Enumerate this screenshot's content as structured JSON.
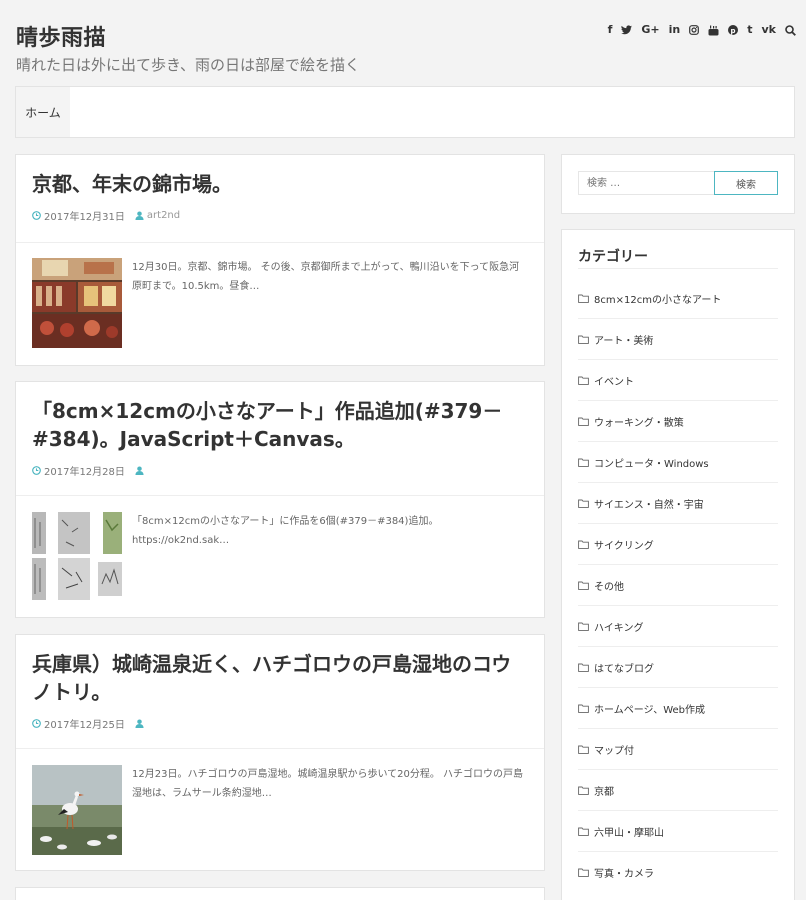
{
  "site": {
    "title": "晴歩雨描",
    "tagline": "晴れた日は外に出て歩き、雨の日は部屋で絵を描く"
  },
  "social": {
    "icons": [
      "facebook-icon",
      "twitter-icon",
      "google-plus-icon",
      "linkedin-icon",
      "instagram-icon",
      "youtube-icon",
      "pinterest-icon",
      "tumblr-icon",
      "vk-icon",
      "search-icon"
    ],
    "glyphs": [
      "f",
      "t",
      "G+",
      "in",
      "ig",
      "yt",
      "p",
      "t",
      "vk",
      ""
    ]
  },
  "nav": {
    "home": "ホーム"
  },
  "posts": [
    {
      "title": "京都、年末の錦市場。",
      "date": "2017年12月31日",
      "author": "art2nd",
      "excerpt": "12月30日。京都、錦市場。 その後、京都御所まで上がって、鴨川沿いを下って阪急河原町まで。10.5km。昼食…"
    },
    {
      "title": "「8cm×12cmの小さなアート」作品追加(#379－#384)。JavaScript＋Canvas。",
      "date": "2017年12月28日",
      "author": "",
      "excerpt": "「8cm×12cmの小さなアート」に作品を6個(#379－#384)追加。 https://ok2nd.sak…"
    },
    {
      "title": "兵庫県）城崎温泉近く、ハチゴロウの戸島湿地のコウノトリ。",
      "date": "2017年12月25日",
      "author": "",
      "excerpt": "12月23日。ハチゴロウの戸島湿地。城崎温泉駅から歩いて20分程。 ハチゴロウの戸島湿地は、ラムサール条約湿地…"
    }
  ],
  "search": {
    "placeholder": "検索 …",
    "button": "検索"
  },
  "categories": {
    "title": "カテゴリー",
    "items": [
      "8cm×12cmの小さなアート",
      "アート・美術",
      "イベント",
      "ウォーキング・散策",
      "コンピュータ・Windows",
      "サイエンス・自然・宇宙",
      "サイクリング",
      "その他",
      "ハイキング",
      "はてなブログ",
      "ホームページ、Web作成",
      "マップ付",
      "京都",
      "六甲山・摩耶山",
      "写真・カメラ"
    ]
  },
  "colors": {
    "accent": "#4db6c1",
    "background": "#f3f3f3"
  }
}
